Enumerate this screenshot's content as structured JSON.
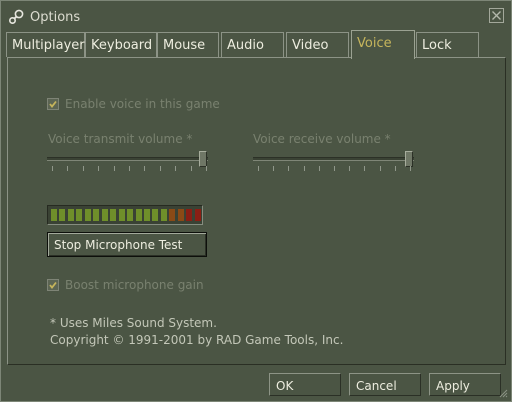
{
  "window": {
    "title": "Options"
  },
  "tabs": [
    {
      "label": "Multiplayer"
    },
    {
      "label": "Keyboard"
    },
    {
      "label": "Mouse"
    },
    {
      "label": "Audio"
    },
    {
      "label": "Video"
    },
    {
      "label": "Voice",
      "active": true
    },
    {
      "label": "Lock"
    }
  ],
  "voice": {
    "enable_label": "Enable voice in this game",
    "enable_checked": true,
    "transmit_label": "Voice transmit volume *",
    "transmit_level": 1.0,
    "receive_label": "Voice receive volume *",
    "receive_level": 1.0,
    "meter_segments": 18,
    "test_button_label": "Stop Microphone Test",
    "boost_label": "Boost microphone gain",
    "boost_checked": true,
    "footnote": "* Uses Miles Sound System.",
    "copyright": "Copyright © 1991-2001 by RAD Game Tools, Inc."
  },
  "footer": {
    "ok_label": "OK",
    "cancel_label": "Cancel",
    "apply_label": "Apply"
  },
  "colors": {
    "accent_tab_text": "#c6b55c",
    "meter_green": "#6f8f2a",
    "meter_orange": "#8a4a16",
    "meter_red": "#8a1e14"
  }
}
